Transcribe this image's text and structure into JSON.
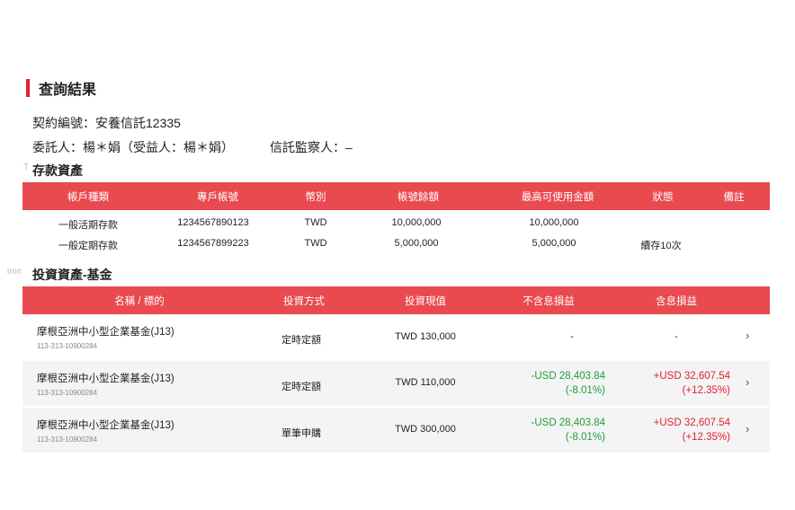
{
  "page_title": "查詢結果",
  "contract_line": "契約編號：安養信託12335",
  "truster_line": "委託人：楊＊娟（受益人：楊＊娟）",
  "supervisor_line": "信託監察人：–",
  "ghost_left_1": "T",
  "ghost_left_2": "ime",
  "deposits": {
    "title": "存款資產",
    "headers": [
      "帳戶種類",
      "專戶帳號",
      "幣別",
      "帳號餘額",
      "最高可使用金額",
      "狀態",
      "備註"
    ],
    "rows": [
      {
        "type": "一般活期存款",
        "account": "1234567890123",
        "currency": "TWD",
        "balance": "10,000,000",
        "available": "10,000,000",
        "status": "",
        "note": ""
      },
      {
        "type": "一般定期存款",
        "account": "1234567899223",
        "currency": "TWD",
        "balance": "5,000,000",
        "available": "5,000,000",
        "status": "續存10次",
        "note": ""
      }
    ]
  },
  "funds": {
    "title": "投資資產-基金",
    "headers": [
      "名稱 / 標的",
      "投資方式",
      "投資現值",
      "不含息損益",
      "含息損益"
    ],
    "rows": [
      {
        "name": "摩根亞洲中小型企業基金(J13)",
        "code": "113-313-10900284",
        "method": "定時定額",
        "value": "TWD 130,000",
        "pl_ex": "-",
        "pl_ex_pct": "",
        "pl_in": "-",
        "pl_in_pct": ""
      },
      {
        "name": "摩根亞洲中小型企業基金(J13)",
        "code": "113-313-10900284",
        "method": "定時定額",
        "value": "TWD 110,000",
        "pl_ex": "-USD 28,403.84",
        "pl_ex_pct": "(-8.01%)",
        "pl_in": "+USD 32,607.54",
        "pl_in_pct": "(+12.35%)"
      },
      {
        "name": "摩根亞洲中小型企業基金(J13)",
        "code": "113-313-10900284",
        "method": "單筆申購",
        "value": "TWD 300,000",
        "pl_ex": "-USD 28,403.84",
        "pl_ex_pct": "(-8.01%)",
        "pl_in": "+USD 32,607.54",
        "pl_in_pct": "(+12.35%)"
      }
    ]
  },
  "colors": {
    "accent": "#e0212f",
    "header_bg": "#e84a50",
    "loss": "#1f9d3a",
    "gain": "#e0212f"
  },
  "icons": {
    "row_arrow": "chevron-right-icon"
  }
}
